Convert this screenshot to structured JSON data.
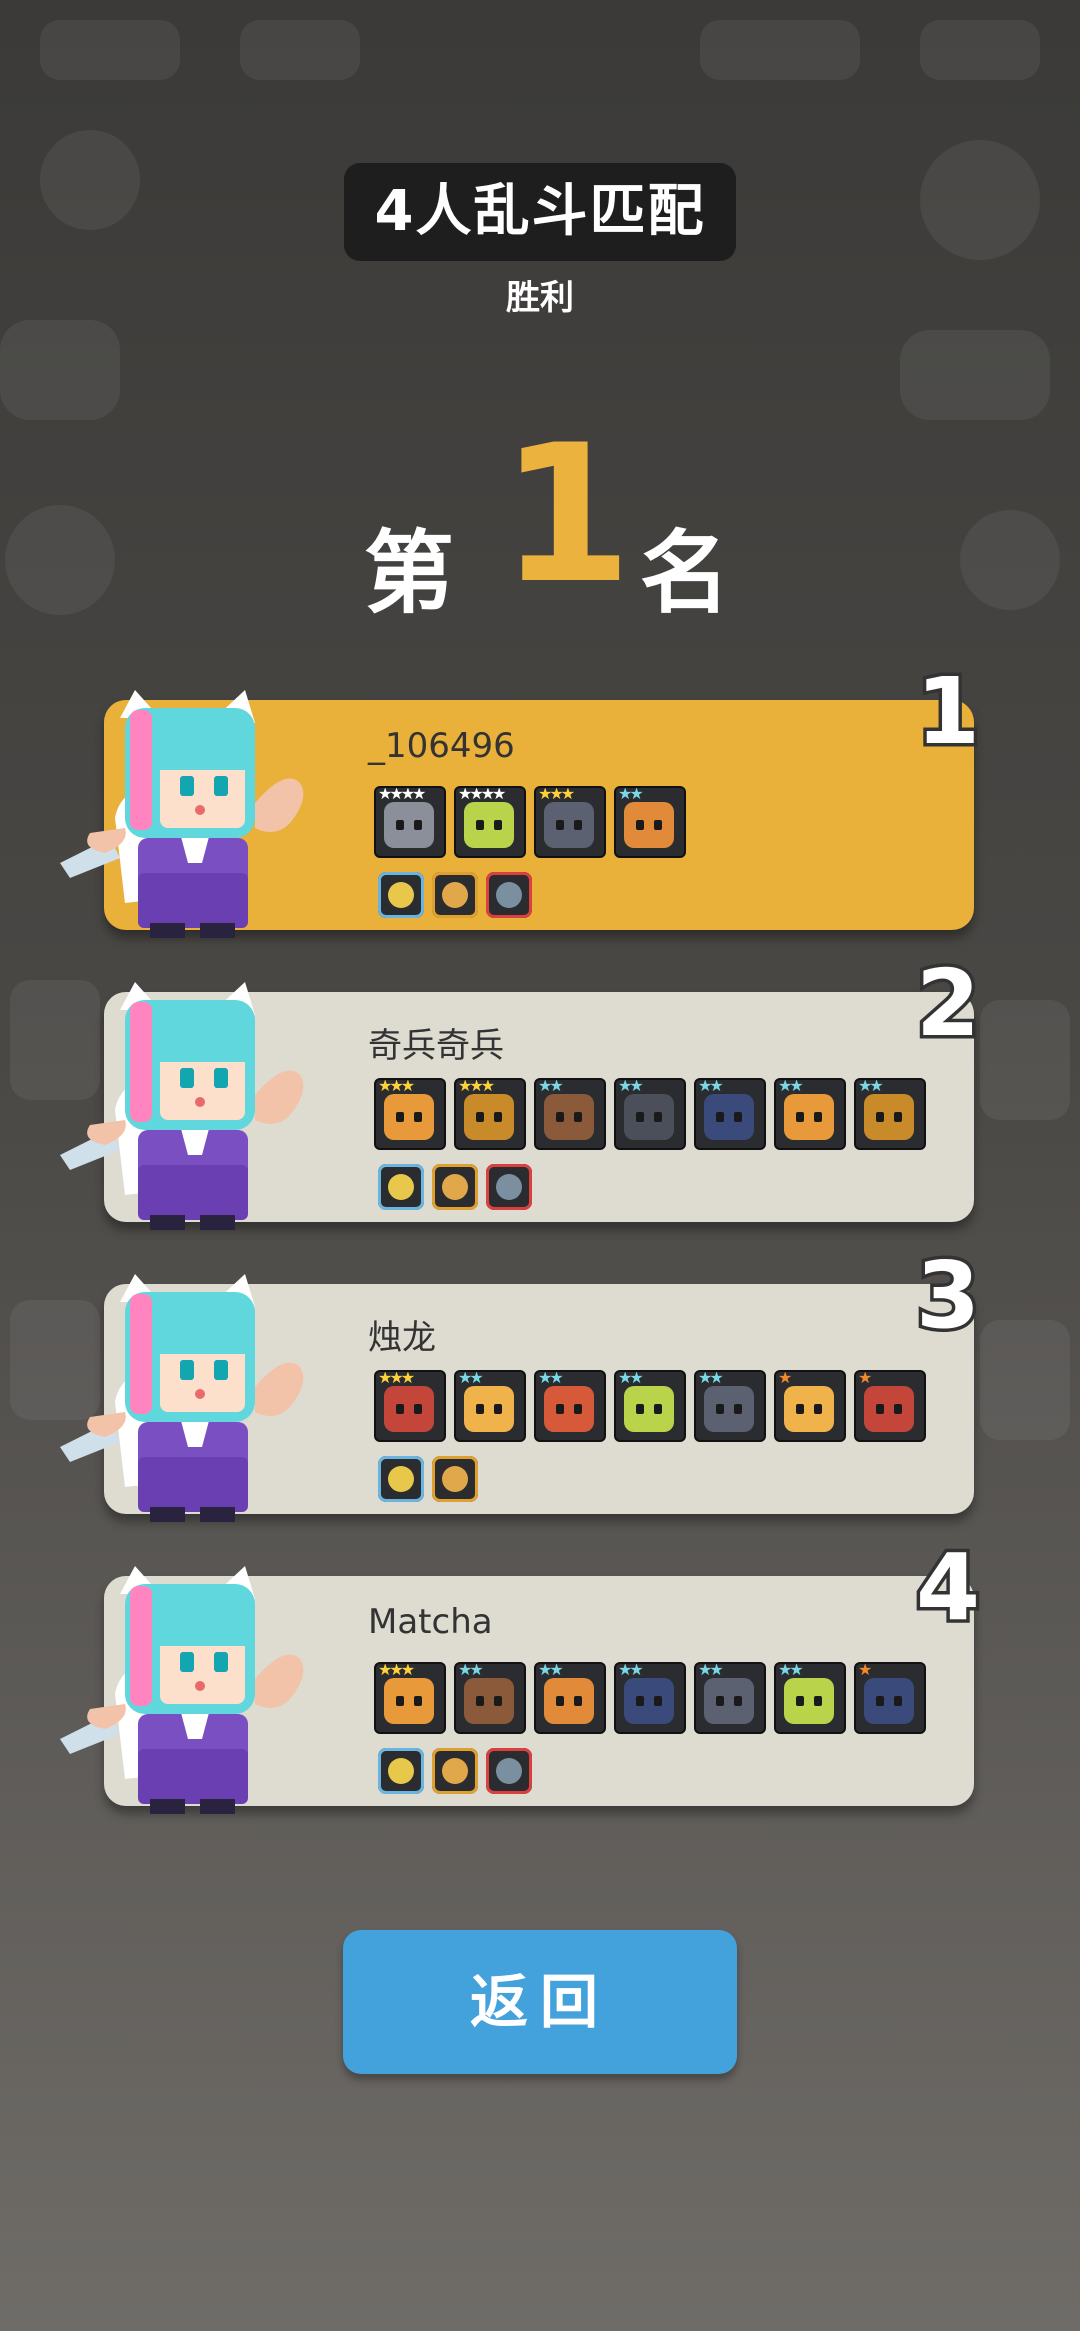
{
  "header": {
    "mode_title": "4人乱斗匹配",
    "result": "胜利",
    "rank_prefix": "第",
    "rank_number": "1",
    "rank_suffix": "名"
  },
  "players": [
    {
      "rank": "1",
      "name": "_106496",
      "card_color": "#eab13a",
      "units": [
        {
          "stars": "4",
          "color": "#8a8f99"
        },
        {
          "stars": "4",
          "color": "#b9d44a"
        },
        {
          "stars": "3",
          "color": "#5b6170"
        },
        {
          "stars": "2",
          "color": "#e08a3a"
        }
      ],
      "items": [
        "gold-chest-icon",
        "gold-chest-icon",
        "spiked-shield-icon"
      ]
    },
    {
      "rank": "2",
      "name": "奇兵奇兵",
      "card_color": "#dedbd1",
      "units": [
        {
          "stars": "3",
          "color": "#e89a3a"
        },
        {
          "stars": "3",
          "color": "#c98a2a"
        },
        {
          "stars": "2",
          "color": "#8a5a3a"
        },
        {
          "stars": "2",
          "color": "#4a4f5a"
        },
        {
          "stars": "2",
          "color": "#3a4a7a"
        },
        {
          "stars": "2",
          "color": "#e89a3a"
        },
        {
          "stars": "2",
          "color": "#c98a2a"
        }
      ],
      "items": [
        "helmet-icon",
        "bread-icon",
        "crown-icon"
      ]
    },
    {
      "rank": "3",
      "name": "烛龙",
      "card_color": "#dedbd1",
      "units": [
        {
          "stars": "3",
          "color": "#c4453a"
        },
        {
          "stars": "2",
          "color": "#f0b24a"
        },
        {
          "stars": "2",
          "color": "#d65a3a"
        },
        {
          "stars": "2",
          "color": "#b9d44a"
        },
        {
          "stars": "2",
          "color": "#5b6170"
        },
        {
          "stars": "1",
          "color": "#f0b24a"
        },
        {
          "stars": "1",
          "color": "#c4453a"
        }
      ],
      "items": [
        "ghost-icon",
        "gold-nuggets-icon"
      ]
    },
    {
      "rank": "4",
      "name": "Matcha",
      "card_color": "#dedbd1",
      "units": [
        {
          "stars": "3",
          "color": "#e89a3a"
        },
        {
          "stars": "2",
          "color": "#8a5a3a"
        },
        {
          "stars": "2",
          "color": "#e08a3a"
        },
        {
          "stars": "2",
          "color": "#3a4a7a"
        },
        {
          "stars": "2",
          "color": "#5b6170"
        },
        {
          "stars": "2",
          "color": "#b9d44a"
        },
        {
          "stars": "1",
          "color": "#3a4a7a"
        }
      ],
      "items": [
        "snake-icon",
        "helmet-icon",
        "mushroom-icon"
      ]
    }
  ],
  "back_button": {
    "label": "返回",
    "color": "#43a2db"
  }
}
